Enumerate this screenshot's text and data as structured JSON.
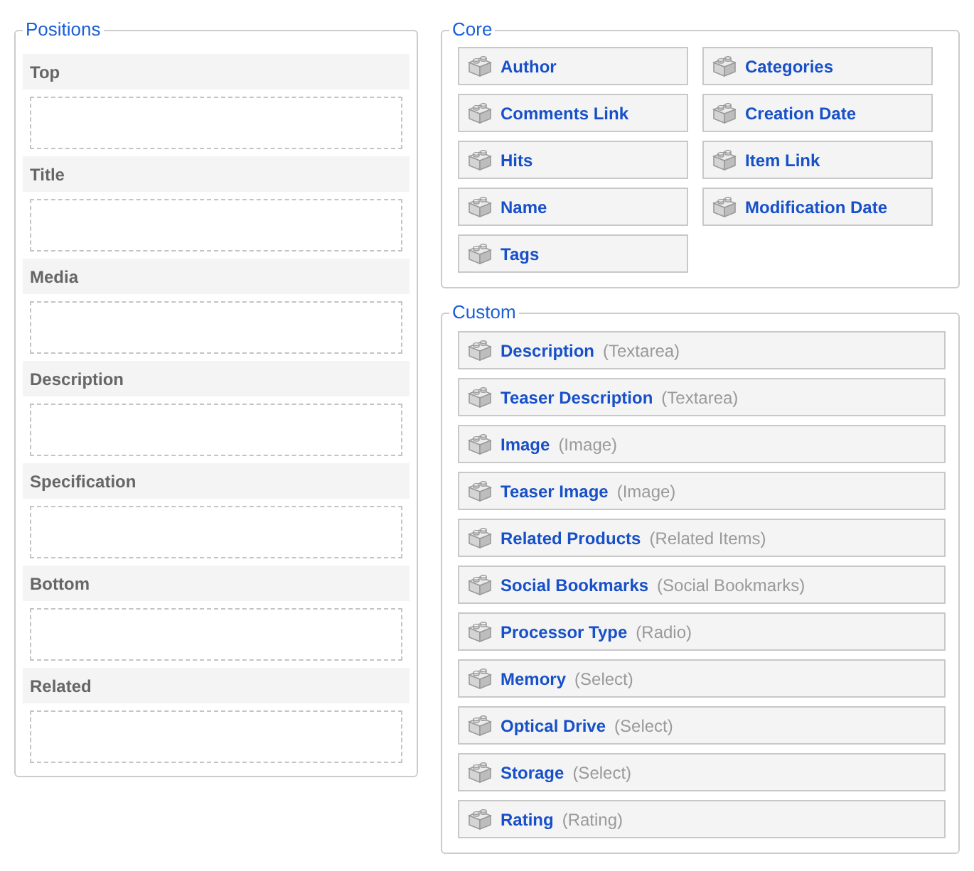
{
  "positions": {
    "title": "Positions",
    "items": [
      {
        "label": "Top"
      },
      {
        "label": "Title"
      },
      {
        "label": "Media"
      },
      {
        "label": "Description"
      },
      {
        "label": "Specification"
      },
      {
        "label": "Bottom"
      },
      {
        "label": "Related"
      }
    ]
  },
  "core": {
    "title": "Core",
    "elements": [
      {
        "name": "Author"
      },
      {
        "name": "Categories"
      },
      {
        "name": "Comments Link"
      },
      {
        "name": "Creation Date"
      },
      {
        "name": "Hits"
      },
      {
        "name": "Item Link"
      },
      {
        "name": "Name"
      },
      {
        "name": "Modification Date"
      },
      {
        "name": "Tags"
      }
    ]
  },
  "custom": {
    "title": "Custom",
    "elements": [
      {
        "name": "Description",
        "type": "(Textarea)"
      },
      {
        "name": "Teaser Description",
        "type": "(Textarea)"
      },
      {
        "name": "Image",
        "type": "(Image)"
      },
      {
        "name": "Teaser Image",
        "type": "(Image)"
      },
      {
        "name": "Related Products",
        "type": "(Related Items)"
      },
      {
        "name": "Social Bookmarks",
        "type": "(Social Bookmarks)"
      },
      {
        "name": "Processor Type",
        "type": "(Radio)"
      },
      {
        "name": "Memory",
        "type": "(Select)"
      },
      {
        "name": "Optical Drive",
        "type": "(Select)"
      },
      {
        "name": "Storage",
        "type": "(Select)"
      },
      {
        "name": "Rating",
        "type": "(Rating)"
      }
    ]
  }
}
